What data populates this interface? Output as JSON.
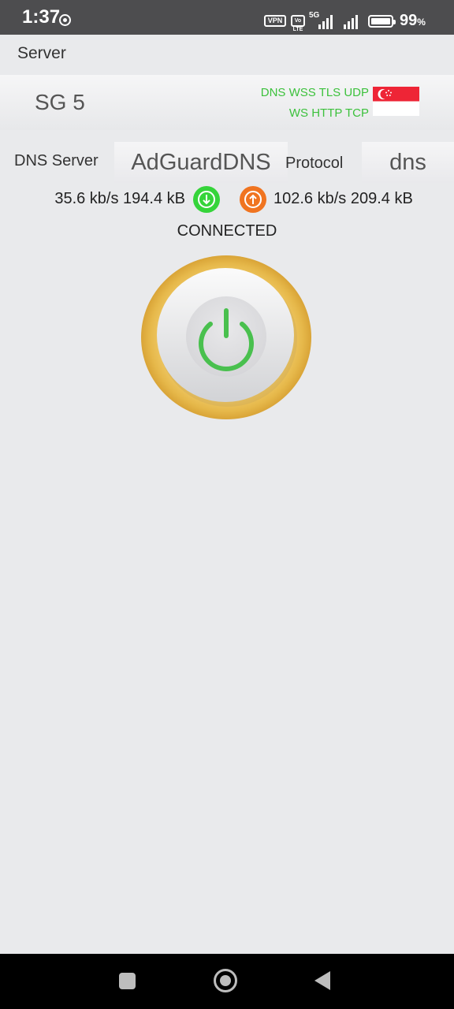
{
  "status_bar": {
    "time": "1:37",
    "vpn_badge": "VPN",
    "volte_badge": "Vo LTE",
    "network": "5G",
    "battery": "99",
    "battery_unit": "%"
  },
  "header": {
    "title": "Server"
  },
  "server": {
    "name": "SG 5",
    "protocols_line1": "DNS WSS TLS UDP",
    "protocols_line2": "WS HTTP TCP",
    "flag_icon": "singapore-flag"
  },
  "settings": {
    "dns_label": "DNS Server",
    "dns_value": "AdGuardDNS",
    "protocol_label": "Protocol",
    "protocol_value": "dns"
  },
  "traffic": {
    "download": "35.6 kb/s 194.4 kB",
    "upload": "102.6 kb/s 209.4 kB",
    "download_icon": "download-icon",
    "upload_icon": "upload-icon"
  },
  "connection": {
    "status": "CONNECTED"
  },
  "colors": {
    "accent_green": "#3cc13c",
    "download_green": "#35d43a",
    "upload_orange": "#f07420",
    "ring_gold": "#e6b84a"
  },
  "nav": {
    "recents_icon": "square-icon",
    "home_icon": "circle-icon",
    "back_icon": "triangle-back-icon"
  }
}
